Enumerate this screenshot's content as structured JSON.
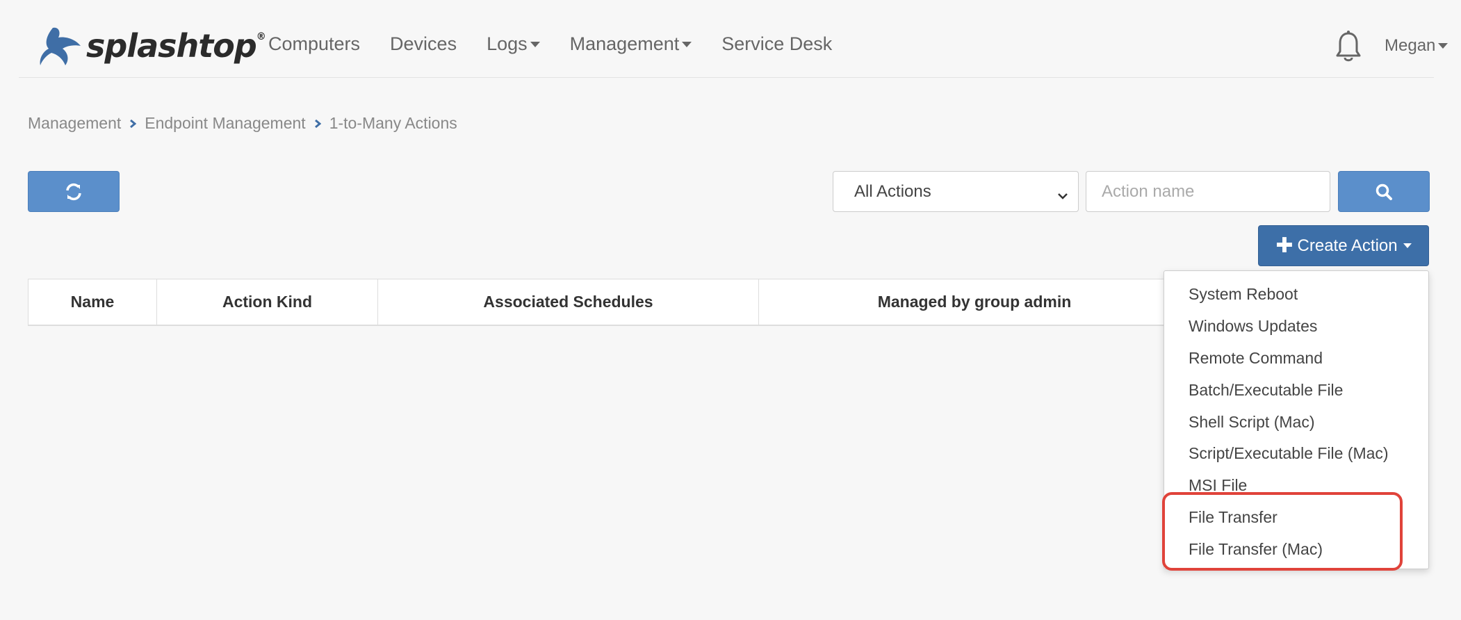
{
  "brand": {
    "name": "splashtop",
    "mark": "®"
  },
  "nav": {
    "items": [
      {
        "label": "Computers",
        "dropdown": false
      },
      {
        "label": "Devices",
        "dropdown": false
      },
      {
        "label": "Logs",
        "dropdown": true
      },
      {
        "label": "Management",
        "dropdown": true
      },
      {
        "label": "Service Desk",
        "dropdown": false
      }
    ],
    "notifications_icon": "bell-icon",
    "user": "Megan"
  },
  "breadcrumb": [
    "Management",
    "Endpoint Management",
    "1-to-Many Actions"
  ],
  "toolbar": {
    "refresh_icon": "refresh-icon",
    "filter_value": "All Actions",
    "search_placeholder": "Action name",
    "search_icon": "search-icon",
    "create_label": "Create Action"
  },
  "table": {
    "columns": [
      "Name",
      "Action Kind",
      "Associated Schedules",
      "Managed by group admin"
    ]
  },
  "create_menu": {
    "items": [
      "System Reboot",
      "Windows Updates",
      "Remote Command",
      "Batch/Executable File",
      "Shell Script (Mac)",
      "Script/Executable File (Mac)",
      "MSI File",
      "File Transfer",
      "File Transfer (Mac)"
    ],
    "highlight_color": "#e0433a"
  },
  "colors": {
    "primary": "#5b8fcb",
    "primary_dark": "#3d6fa8",
    "brand": "#3f6ea6"
  }
}
